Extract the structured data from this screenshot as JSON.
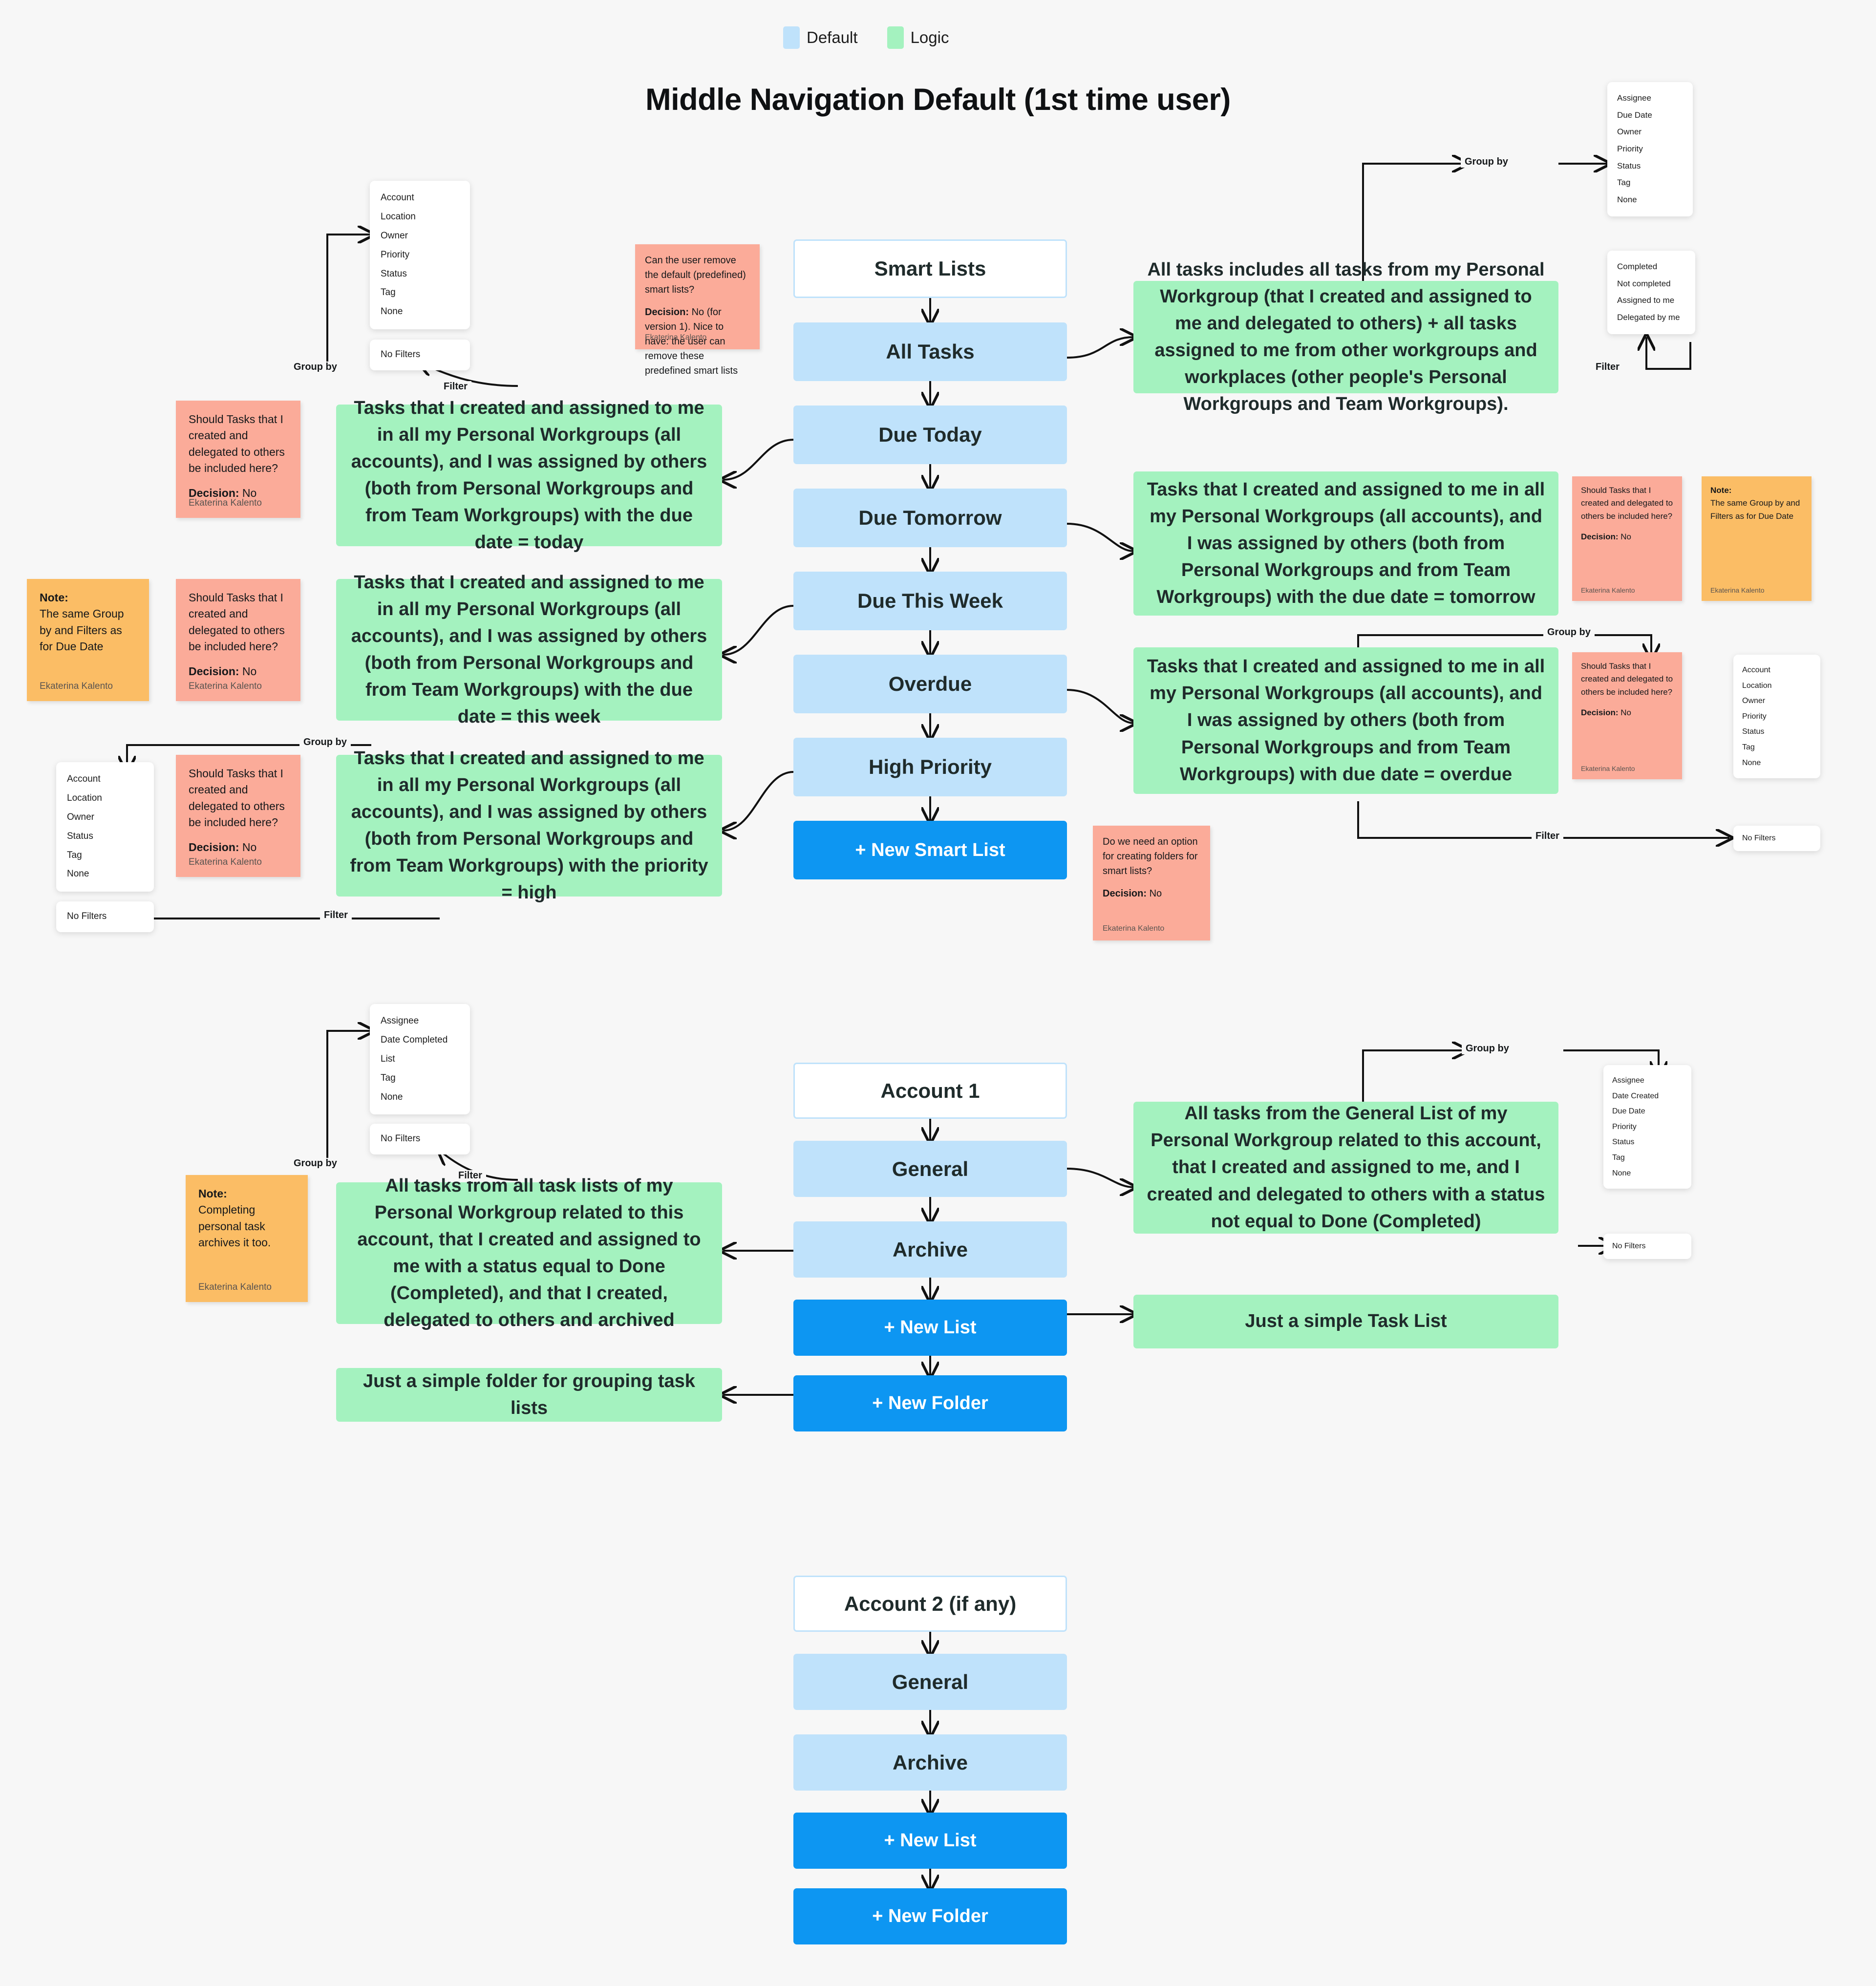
{
  "legend": {
    "items": [
      {
        "label": "Default",
        "color": "#bfe2fb"
      },
      {
        "label": "Logic",
        "color": "#a4f2bf"
      }
    ]
  },
  "title": "Middle Navigation Default (1st time user)",
  "author": "Ekaterina Kalento",
  "connector_labels": {
    "group_by": "Group by",
    "filter": "Filter"
  },
  "sections": {
    "smart_lists": {
      "head": "Smart Lists",
      "nodes": [
        "All Tasks",
        "Due Today",
        "Due Tomorrow",
        "Due This Week",
        "Overdue",
        "High Priority"
      ],
      "action": "+ New Smart List",
      "logic": {
        "all_tasks": "All tasks includes all tasks from my Personal Workgroup (that I created and assigned to me and delegated to others) + all tasks assigned to me from other workgroups and workplaces (other people's Personal Workgroups and Team Workgroups).",
        "due_today": "Tasks that I created and assigned to me in all my Personal Workgroups (all accounts), and I was assigned by others (both from Personal Workgroups and from Team Workgroups) with the due date = today",
        "due_tomorrow": "Tasks that I created and assigned to me in all my Personal Workgroups (all accounts), and I was assigned by others (both from Personal Workgroups and from Team Workgroups) with the due date = tomorrow",
        "due_this_week": "Tasks that I created and assigned to me in all my Personal Workgroups (all accounts), and I was assigned by others (both from Personal Workgroups and from Team Workgroups) with the due date = this week",
        "overdue": "Tasks that I created and assigned to me in all my Personal Workgroups (all accounts), and I was assigned by others (both from Personal Workgroups and from Team Workgroups) with due date = overdue",
        "high_priority": "Tasks that I created and assigned to me in all my Personal Workgroups (all accounts), and I was assigned by others (both from Personal Workgroups and from Team Workgroups) with the priority = high"
      }
    },
    "account1": {
      "head": "Account 1",
      "nodes": [
        "General",
        "Archive"
      ],
      "actions": [
        "+ New List",
        "+ New Folder"
      ],
      "logic": {
        "general": "All tasks from the General List of my Personal Workgroup related to this account, that I created and assigned to me, and I created and delegated to others with a status not equal to Done (Completed)",
        "archive": "All tasks from all task lists of my Personal Workgroup related to this account, that I created and assigned to me with a status equal to Done (Completed), and that I created, delegated to others and archived",
        "new_list": "Just a simple Task List",
        "new_folder": "Just a simple folder for grouping task lists"
      }
    },
    "account2": {
      "head": "Account 2 (if any)",
      "nodes": [
        "General",
        "Archive"
      ],
      "actions": [
        "+ New List",
        "+ New Folder"
      ]
    }
  },
  "menus": {
    "smart_all_tasks_group_by": [
      "Assignee",
      "Due Date",
      "Owner",
      "Priority",
      "Status",
      "Tag",
      "None"
    ],
    "smart_all_tasks_filter": [
      "Completed",
      "Not completed",
      "Assigned to me",
      "Delegated by me"
    ],
    "due_today_group_by": [
      "Account",
      "Location",
      "Owner",
      "Priority",
      "Status",
      "Tag",
      "None"
    ],
    "due_today_filter": [
      "No Filters"
    ],
    "high_priority_group_by": [
      "Account",
      "Location",
      "Owner",
      "Status",
      "Tag",
      "None"
    ],
    "high_priority_filter": [
      "No Filters"
    ],
    "overdue_group_by": [
      "Account",
      "Location",
      "Owner",
      "Priority",
      "Status",
      "Tag",
      "None"
    ],
    "overdue_filter": [
      "No Filters"
    ],
    "archive_group_by": [
      "Assignee",
      "Date Completed",
      "List",
      "Tag",
      "None"
    ],
    "archive_filter": [
      "No Filters"
    ],
    "general_group_by": [
      "Assignee",
      "Date Created",
      "Due Date",
      "Priority",
      "Status",
      "Tag",
      "None"
    ],
    "general_filter": [
      "No Filters"
    ]
  },
  "notes": {
    "remove_defaults": {
      "body": "Can the user remove the default (predefined) smart lists?\n\n**Decision:** No (for version 1). Nice to have: the user can remove these predefined smart lists",
      "q": "Can the user remove the default (predefined) smart lists?",
      "decision_label": "Decision:",
      "decision_value": "No (for version 1). Nice to have: the user can remove these predefined smart lists"
    },
    "delegated_question": {
      "q": "Should Tasks that I created and delegated to others be included here?",
      "decision_label": "Decision:",
      "decision_value": "No"
    },
    "same_group_by": {
      "label": "Note:",
      "body": "The same Group by and Filters as for Due Date"
    },
    "folders_for_smart_lists": {
      "q": "Do we need an option for creating folders for smart lists?",
      "decision_label": "Decision:",
      "decision_value": "No"
    },
    "archive_note": {
      "label": "Note:",
      "body": "Completing personal task archives it too."
    }
  }
}
